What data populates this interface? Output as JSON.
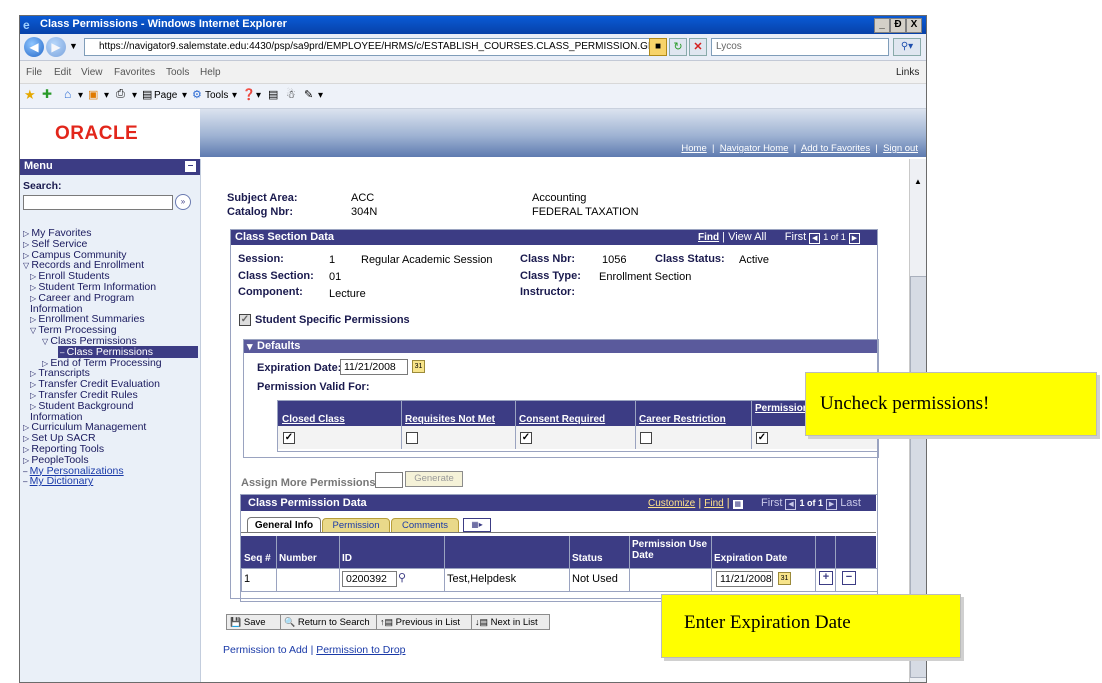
{
  "window": {
    "title": "Class Permissions - Windows Internet Explorer",
    "min": "_",
    "max": "Đ",
    "close": "X"
  },
  "address": {
    "url": "https://navigator9.salemstate.edu:4430/psp/sa9prd/EMPLOYEE/HRMS/c/ESTABLISH_COURSES.CLASS_PERMISSION.GI",
    "search_value": "Lycos"
  },
  "menubar": [
    "File",
    "Edit",
    "View",
    "Favorites",
    "Tools",
    "Help"
  ],
  "menubar_links": "Links",
  "toolbar": {
    "page": "Page",
    "tools": "Tools"
  },
  "brand": {
    "logo": "ORACLE",
    "color": "#e2261b"
  },
  "top_links": [
    "Home",
    "Navigator Home",
    "Add to Favorites",
    "Sign out"
  ],
  "sidebar": {
    "header": "Menu",
    "search_label": "Search:",
    "search_value": "",
    "items": [
      {
        "label": "My Favorites",
        "prefix": "▷",
        "indent": 0
      },
      {
        "label": "Self Service",
        "prefix": "▷",
        "indent": 0
      },
      {
        "label": "Campus Community",
        "prefix": "▷",
        "indent": 0
      },
      {
        "label": "Records and Enrollment",
        "prefix": "▽",
        "indent": 0
      },
      {
        "label": "Enroll Students",
        "prefix": "▷",
        "indent": 1
      },
      {
        "label": "Student Term Information",
        "prefix": "▷",
        "indent": 1
      },
      {
        "label": "Career and Program",
        "prefix": "▷",
        "indent": 1
      },
      {
        "label": "Information",
        "prefix": "",
        "indent": 1
      },
      {
        "label": "Enrollment Summaries",
        "prefix": "▷",
        "indent": 1
      },
      {
        "label": "Term Processing",
        "prefix": "▽",
        "indent": 1
      },
      {
        "label": "Class Permissions",
        "prefix": "▽",
        "indent": 2
      },
      {
        "label": "Class Permissions",
        "prefix": "–",
        "indent": 3
      },
      {
        "label": "End of Term Processing",
        "prefix": "▷",
        "indent": 2
      },
      {
        "label": "Transcripts",
        "prefix": "▷",
        "indent": 1
      },
      {
        "label": "Transfer Credit Evaluation",
        "prefix": "▷",
        "indent": 1
      },
      {
        "label": "Transfer Credit Rules",
        "prefix": "▷",
        "indent": 1
      },
      {
        "label": "Student Background",
        "prefix": "▷",
        "indent": 1
      },
      {
        "label": "Information",
        "prefix": "",
        "indent": 1
      },
      {
        "label": "Curriculum Management",
        "prefix": "▷",
        "indent": 0
      },
      {
        "label": "Set Up SACR",
        "prefix": "▷",
        "indent": 0
      },
      {
        "label": "Reporting Tools",
        "prefix": "▷",
        "indent": 0
      },
      {
        "label": "PeopleTools",
        "prefix": "▷",
        "indent": 0
      },
      {
        "label": "My Personalizations",
        "prefix": "–",
        "indent": 0
      },
      {
        "label": "My Dictionary",
        "prefix": "–",
        "indent": 0
      }
    ]
  },
  "header": {
    "subject_area_label": "Subject Area:",
    "subject_area": "ACC",
    "subject_desc": "Accounting",
    "catalog_label": "Catalog Nbr:",
    "catalog": "304N",
    "catalog_desc": "FEDERAL TAXATION"
  },
  "section": {
    "title": "Class Section Data",
    "find": "Find",
    "view_all": "View All",
    "first": "First",
    "of": "1 of 1",
    "last": "Last",
    "session_label": "Session:",
    "session": "1",
    "session_desc": "Regular Academic Session",
    "class_nbr_label": "Class Nbr:",
    "class_nbr": "1056",
    "class_status_label": "Class Status:",
    "class_status": "Active",
    "class_section_label": "Class Section:",
    "class_section": "01",
    "class_type_label": "Class Type:",
    "class_type": "Enrollment Section",
    "component_label": "Component:",
    "component": "Lecture",
    "instructor_label": "Instructor:",
    "student_specific": "Student Specific Permissions"
  },
  "defaults": {
    "title": "Defaults",
    "expiration_label": "Expiration Date:",
    "expiration": "11/21/2008",
    "permission_valid": "Permission Valid For:",
    "columns": [
      "Closed Class",
      "Requisites Not Met",
      "Consent Required",
      "Career Restriction",
      "Permission T Period"
    ],
    "checked": [
      true,
      false,
      true,
      false,
      true
    ]
  },
  "assign": {
    "label": "Assign More Permissions:",
    "value": "",
    "generate": "Generate"
  },
  "perm_data": {
    "title": "Class Permission Data",
    "customize": "Customize",
    "find": "Find",
    "first": "First",
    "of": "1 of 1",
    "last": "Last",
    "tabs": [
      "General Info",
      "Permission",
      "Comments"
    ],
    "columns": [
      "Seq #",
      "Number",
      "ID",
      "",
      "Status",
      "Permission Use Date",
      "Expiration Date"
    ],
    "row": {
      "seq": "1",
      "number": "",
      "id": "0200392",
      "name": "Test,Helpdesk",
      "status": "Not Used",
      "use_date": "",
      "expiration": "11/21/2008"
    }
  },
  "buttons": {
    "save": "Save",
    "return": "Return to Search",
    "prev": "Previous in List",
    "next": "Next in List"
  },
  "footer_links": {
    "add": "Permission to Add",
    "drop": "Permission to Drop"
  },
  "callouts": {
    "uncheck": "Uncheck permissions!",
    "enter": "Enter Expiration Date"
  }
}
